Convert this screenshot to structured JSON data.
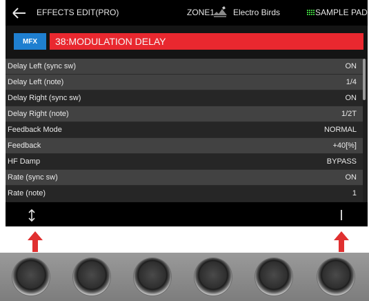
{
  "topbar": {
    "back_icon": "back-arrow-icon",
    "title": "EFFECTS EDIT(PRO)",
    "zone": "ZONE1",
    "tone_icon": "tone-category-icon",
    "tone": "Electro Birds",
    "pad_icon": "sample-pad-grid-icon",
    "pad_label": "SAMPLE PAD"
  },
  "effect": {
    "type": "MFX",
    "name": "38:MODULATION DELAY"
  },
  "params": [
    {
      "label": "Delay Left (sync sw)",
      "value": "ON"
    },
    {
      "label": "Delay Left (note)",
      "value": "1/4"
    },
    {
      "label": "Delay Right (sync sw)",
      "value": "ON"
    },
    {
      "label": "Delay Right (note)",
      "value": "1/2T"
    },
    {
      "label": "Feedback Mode",
      "value": "NORMAL"
    },
    {
      "label": "Feedback",
      "value": "+40[%]"
    },
    {
      "label": "HF Damp",
      "value": "BYPASS"
    },
    {
      "label": "Rate (sync sw)",
      "value": "ON"
    },
    {
      "label": "Rate (note)",
      "value": "1"
    }
  ],
  "bottom": {
    "left_icon": "up-down-arrow-icon",
    "right_icon": "cursor-bar-icon"
  },
  "colors": {
    "accent_red": "#e9282f",
    "mfx_blue": "#1f7fd0",
    "pointer_red": "#e03030"
  },
  "knobs": 6
}
